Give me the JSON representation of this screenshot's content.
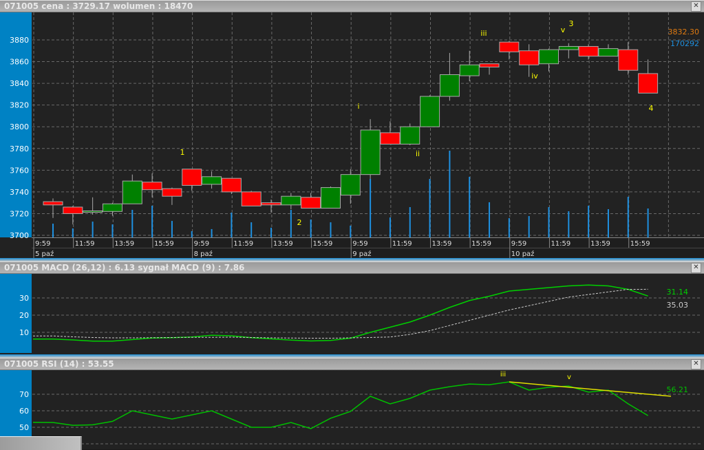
{
  "price_panel": {
    "title": "071005  cena : 3729.17 wolumen : 18470",
    "close_icon": "close-icon",
    "last_price_label": "3832.30",
    "volume_max_label": "170292",
    "colors": {
      "up": "#008000",
      "down": "#ff0000",
      "volume": "#1e90e0",
      "last_price": "#e07a10",
      "volume_label": "#1e90e0",
      "wave_label": "#ffff00"
    },
    "y_ticks": [
      "3700",
      "3720",
      "3740",
      "3760",
      "3780",
      "3800",
      "3820",
      "3840",
      "3860",
      "3880"
    ],
    "time_labels": [
      "9:59",
      "11:59",
      "13:59",
      "15:59",
      "9:59",
      "11:59",
      "13:59",
      "15:59",
      "9:59",
      "11:59",
      "13:59",
      "15:59",
      "9:59",
      "11:59",
      "13:59",
      "15:59"
    ],
    "date_labels": [
      "5 paź",
      "8 paź",
      "9 paź",
      "10 paź"
    ],
    "wave_labels": [
      "1",
      "2",
      "i",
      "ii",
      "iii",
      "iv",
      "v",
      "3",
      "4"
    ]
  },
  "macd_panel": {
    "title": "071005  MACD (26,12) : 6.13 sygnał MACD (9) : 7.86",
    "y_ticks": [
      "10",
      "20",
      "30"
    ],
    "macd_last_label": "31.14",
    "signal_last_label": "35.03",
    "colors": {
      "macd": "#00d000",
      "signal": "#cccccc"
    }
  },
  "rsi_panel": {
    "title": "071005  RSI (14) : 53.55",
    "y_ticks": [
      "50",
      "60",
      "70"
    ],
    "rsi_last_label": "56.21",
    "wave_labels": [
      "iii",
      "v"
    ],
    "colors": {
      "rsi": "#00c000",
      "trendline": "#e0e000"
    }
  },
  "chart_data": [
    {
      "type": "candlestick",
      "ylim": [
        3700,
        3880
      ],
      "grid": true,
      "ohlc": [
        [
          3731,
          3734,
          3716,
          3728
        ],
        [
          3726,
          3727,
          3710,
          3720
        ],
        [
          3722,
          3735,
          3719,
          3722.5
        ],
        [
          3722,
          3730,
          3718,
          3729
        ],
        [
          3729,
          3756,
          3729,
          3750
        ],
        [
          3749,
          3757,
          3735,
          3742
        ],
        [
          3743,
          3744,
          3728,
          3736
        ],
        [
          3761,
          3761,
          3741,
          3746
        ],
        [
          3747,
          3759,
          3743,
          3754
        ],
        [
          3752.5,
          3752.5,
          3738,
          3740
        ],
        [
          3740,
          3741,
          3727,
          3727
        ],
        [
          3730,
          3733,
          3721,
          3728
        ],
        [
          3728,
          3739,
          3724,
          3736
        ],
        [
          3735,
          3739,
          3725,
          3725
        ],
        [
          3725,
          3745,
          3725,
          3744
        ],
        [
          3737,
          3761,
          3729,
          3756
        ],
        [
          3756,
          3807,
          3752,
          3797
        ],
        [
          3794.5,
          3805,
          3784,
          3784
        ],
        [
          3784,
          3803,
          3783,
          3800
        ],
        [
          3800,
          3829,
          3800,
          3828
        ],
        [
          3828,
          3868,
          3824,
          3848
        ],
        [
          3847,
          3870,
          3842,
          3857
        ],
        [
          3858,
          3858,
          3848,
          3855
        ],
        [
          3878,
          3879,
          3862,
          3869
        ],
        [
          3870,
          3876,
          3846,
          3857
        ],
        [
          3858,
          3872,
          3851,
          3871
        ],
        [
          3871,
          3877,
          3863,
          3874
        ],
        [
          3874,
          3876,
          3862,
          3865
        ],
        [
          3865,
          3876,
          3865,
          3872
        ],
        [
          3871,
          3878,
          3848,
          3852
        ],
        [
          3849,
          3862,
          3831,
          3831
        ]
      ],
      "volume": [
        13100,
        9000,
        14900,
        12500,
        25100,
        28700,
        15500,
        6600,
        8400,
        22700,
        14300,
        9600,
        25100,
        16700,
        14300,
        11400,
        52000,
        18500,
        27500,
        52000,
        76500,
        53800,
        31700,
        17900,
        19700,
        27500,
        23900,
        28700,
        25700,
        36400,
        26300
      ]
    },
    {
      "type": "line",
      "ylim": [
        0,
        40
      ],
      "series": [
        {
          "name": "MACD (26,12)",
          "values": [
            6.1,
            5.6,
            4.9,
            4.9,
            5.8,
            6.7,
            6.9,
            7.3,
            8.3,
            8.0,
            6.9,
            6.2,
            5.5,
            5.0,
            5.3,
            6.6,
            10,
            13,
            16,
            20,
            24.5,
            28.5,
            31,
            34,
            35,
            36,
            37,
            37.5,
            37,
            35,
            31.14
          ]
        },
        {
          "name": "sygnał MACD (9)",
          "values": [
            7.9,
            7.4,
            7.0,
            6.8,
            6.8,
            6.9,
            7.0,
            7.1,
            7.1,
            7.2,
            7.0,
            6.8,
            6.7,
            6.6,
            6.6,
            6.8,
            7.0,
            7.3,
            8.8,
            11,
            14,
            17,
            20,
            23,
            25.5,
            28,
            30.5,
            32,
            33.5,
            35,
            35.03
          ]
        }
      ]
    },
    {
      "type": "line",
      "ylim": [
        40,
        80
      ],
      "series": [
        {
          "name": "RSI (14)",
          "values": [
            53,
            52.9,
            51.2,
            51.5,
            53.6,
            60,
            57.5,
            55,
            57.5,
            60,
            55,
            50,
            50,
            52.9,
            49.2,
            55.5,
            59.6,
            68.8,
            64.2,
            67.5,
            72.5,
            74.6,
            76.2,
            75.8,
            77.5,
            72.5,
            74.2,
            75,
            71.3,
            72.5,
            64.2,
            57.1
          ]
        }
      ],
      "trendline": [
        [
          77.5,
          68.8
        ]
      ]
    }
  ]
}
